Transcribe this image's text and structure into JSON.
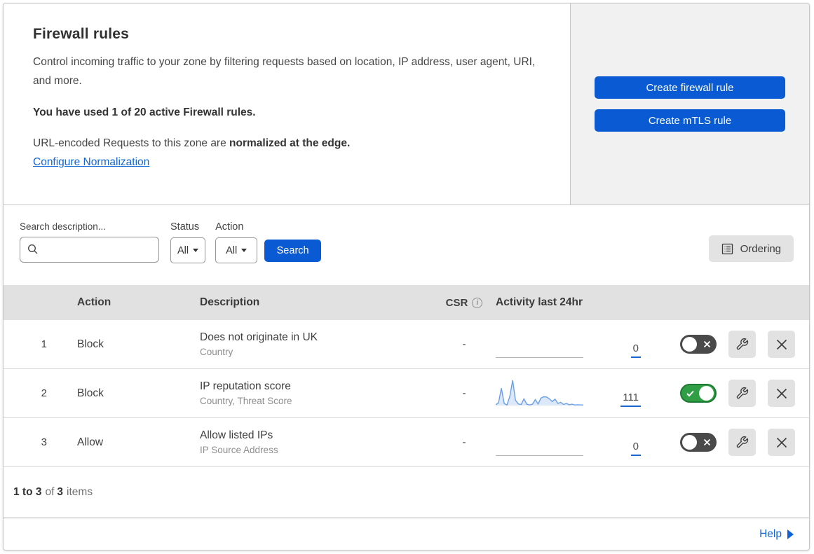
{
  "header": {
    "title": "Firewall rules",
    "description": "Control incoming traffic to your zone by filtering requests based on location, IP address, user agent, URI, and more.",
    "usage": "You have used 1 of 20 active Firewall rules.",
    "normalization_prefix": "URL-encoded Requests to this zone are ",
    "normalization_bold": "normalized at the edge.",
    "normalization_link": "Configure Normalization",
    "create_firewall_button": "Create firewall rule",
    "create_mtls_button": "Create mTLS rule"
  },
  "filters": {
    "search_label": "Search description...",
    "search_value": "",
    "status_label": "Status",
    "status_value": "All",
    "action_label": "Action",
    "action_value": "All",
    "search_button": "Search",
    "ordering_button": "Ordering"
  },
  "table": {
    "columns": {
      "action": "Action",
      "description": "Description",
      "csr": "CSR",
      "activity": "Activity last 24hr"
    },
    "rows": [
      {
        "num": "1",
        "action": "Block",
        "description": "Does not originate in UK",
        "fields": "Country",
        "csr": "-",
        "activity_count": "0",
        "enabled": false,
        "has_sparkline": false
      },
      {
        "num": "2",
        "action": "Block",
        "description": "IP reputation score",
        "fields": "Country, Threat Score",
        "csr": "-",
        "activity_count": "111",
        "enabled": true,
        "has_sparkline": true
      },
      {
        "num": "3",
        "action": "Allow",
        "description": "Allow listed IPs",
        "fields": "IP Source Address",
        "csr": "-",
        "activity_count": "0",
        "enabled": false,
        "has_sparkline": false
      }
    ]
  },
  "footer": {
    "range": "1 to 3",
    "of_word": "of",
    "total": "3",
    "items_word": "items",
    "help_label": "Help"
  },
  "icons": {
    "search": "magnifier",
    "ordering": "list-document",
    "csr_info": "info-circle",
    "edit": "wrench",
    "delete": "x-mark",
    "toggle_off": "x-mark",
    "toggle_on": "check-mark",
    "dropdown": "caret-down",
    "help": "triangle-right"
  },
  "colors": {
    "accent_blue": "#0a5bd3",
    "link_blue": "#1366d6",
    "toggle_on_green": "#2f9e44",
    "toggle_off_gray": "#4a4a4a",
    "sparkline_stroke": "#6b9fe4",
    "sparkline_fill": "#dce8f8",
    "table_header_bg": "#e1e1e1",
    "panel_bg": "#f1f1f1"
  },
  "sparkline": {
    "width": 125,
    "height": 42,
    "values": [
      0.03,
      0.1,
      0.65,
      0.08,
      0.02,
      0.35,
      0.95,
      0.2,
      0.06,
      0.04,
      0.25,
      0.05,
      0.02,
      0.05,
      0.22,
      0.06,
      0.28,
      0.33,
      0.32,
      0.25,
      0.15,
      0.24,
      0.08,
      0.12,
      0.04,
      0.08,
      0.03,
      0.05,
      0.02,
      0.03,
      0.02,
      0.02
    ]
  }
}
